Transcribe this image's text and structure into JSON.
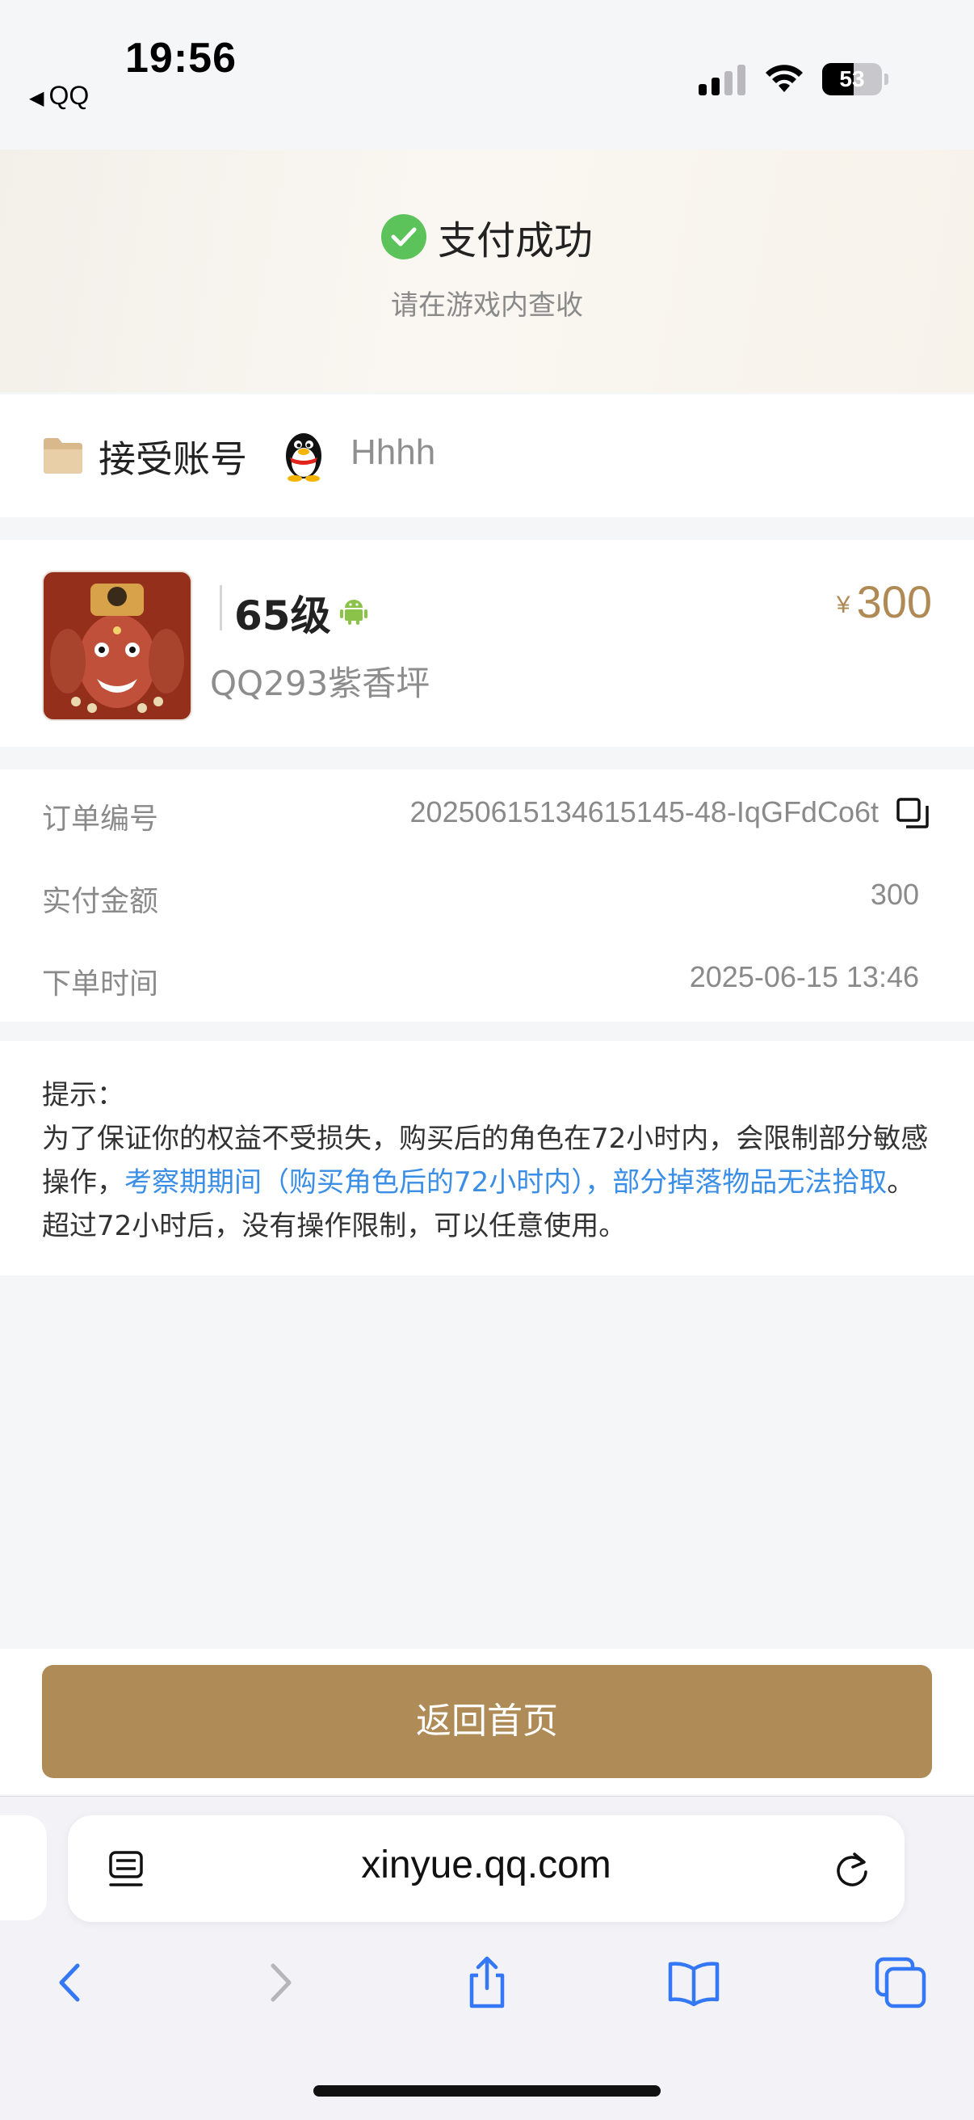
{
  "status_bar": {
    "time": "19:56",
    "back_app": "QQ",
    "battery_level": "53",
    "battery_fraction": 0.53
  },
  "header": {
    "title": "支付成功",
    "subtitle": "请在游戏内查收"
  },
  "account": {
    "label": "接受账号",
    "name": "Hhhh"
  },
  "product": {
    "level": "65级",
    "price_symbol": "¥",
    "price": "300",
    "server": "QQ293紫香坪"
  },
  "order": {
    "order_no_label": "订单编号",
    "order_no": "20250615134615145-48-IqGFdCo6t",
    "paid_label": "实付金额",
    "paid": "300",
    "time_label": "下单时间",
    "time": "2025-06-15 13:46"
  },
  "tip": {
    "title": "提示：",
    "text_before": "为了保证你的权益不受损失，购买后的角色在72小时内，会限制部分敏感操作，",
    "highlight": "考察期期间（购买角色后的72小时内），部分掉落物品无法拾取",
    "text_after": "。超过72小时后，没有操作限制，可以任意使用。"
  },
  "button": {
    "home": "返回首页"
  },
  "browser": {
    "url": "xinyue.qq.com"
  },
  "colors": {
    "accent_gold": "#af8b57",
    "price_gold": "#b08a55",
    "success_green": "#5bc35a",
    "link_blue": "#3a8ee6",
    "safari_blue": "#3478f6"
  }
}
